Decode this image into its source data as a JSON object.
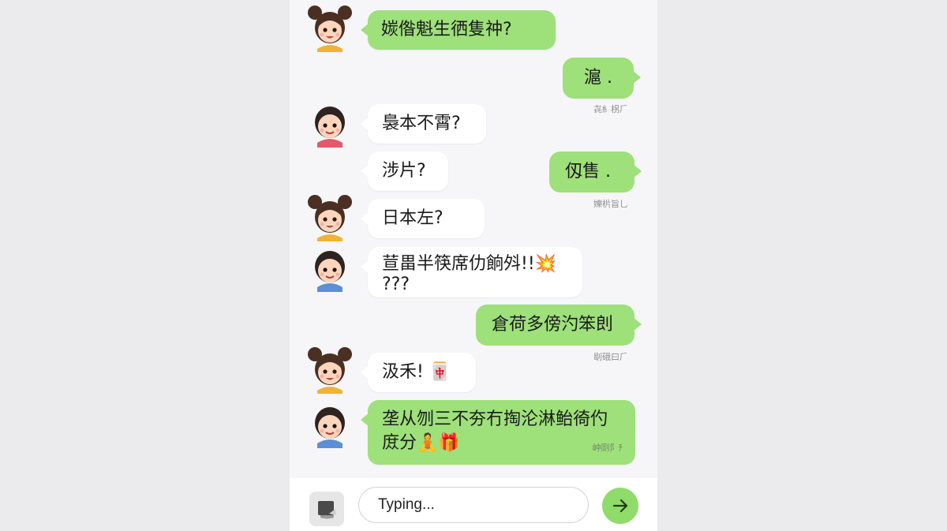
{
  "colors": {
    "outgoing_bubble": "#9ee07a",
    "incoming_bubble": "#ffffff",
    "send_button": "#8fdc6a",
    "background": "#ebebee"
  },
  "messages": [
    {
      "id": "m1",
      "side": "in-green",
      "avatar": "girl-avatar",
      "lines": [
        "㛶偺魁生徆隻祌?"
      ]
    },
    {
      "id": "m2",
      "side": "out",
      "lines": [
        "滬 ."
      ],
      "timestamp": "㐂⺯柺⺁"
    },
    {
      "id": "m3",
      "side": "in",
      "avatar": "boy-avatar",
      "lines": [
        "裊本不霄?"
      ]
    },
    {
      "id": "m4",
      "side": "in",
      "lines": [
        "涉片?"
      ]
    },
    {
      "id": "m5",
      "side": "out",
      "lines": [
        "仭售 ."
      ],
      "timestamp": "㜰㭊旨乚"
    },
    {
      "id": "m6",
      "side": "in",
      "avatar": "girl-avatar",
      "lines": [
        "日本左?"
      ]
    },
    {
      "id": "m7",
      "side": "in",
      "avatar": "boy-avatar",
      "lines": [
        "荁畕半筷席仂餉斘!!💥",
        "???"
      ]
    },
    {
      "id": "m8",
      "side": "out",
      "lines": [
        "倉荷多傍汋笨剆"
      ],
      "timestamp": "㓭硪⽈⺁"
    },
    {
      "id": "m9",
      "side": "in",
      "avatar": "girl-avatar",
      "lines": [
        "汲禾! 🀄"
      ]
    },
    {
      "id": "m10",
      "side": "in-green",
      "avatar": "boy-avatar",
      "lines": [
        "垄从刎三不夯冇掏沦淋鲐徛仢",
        "庻分🧘🎁"
      ],
      "timestamp": "㞲㓹⻖ﾁ"
    }
  ],
  "input": {
    "value": "Typing...",
    "attach_icon": "image-attach-icon",
    "send_icon": "arrow-right-icon"
  }
}
